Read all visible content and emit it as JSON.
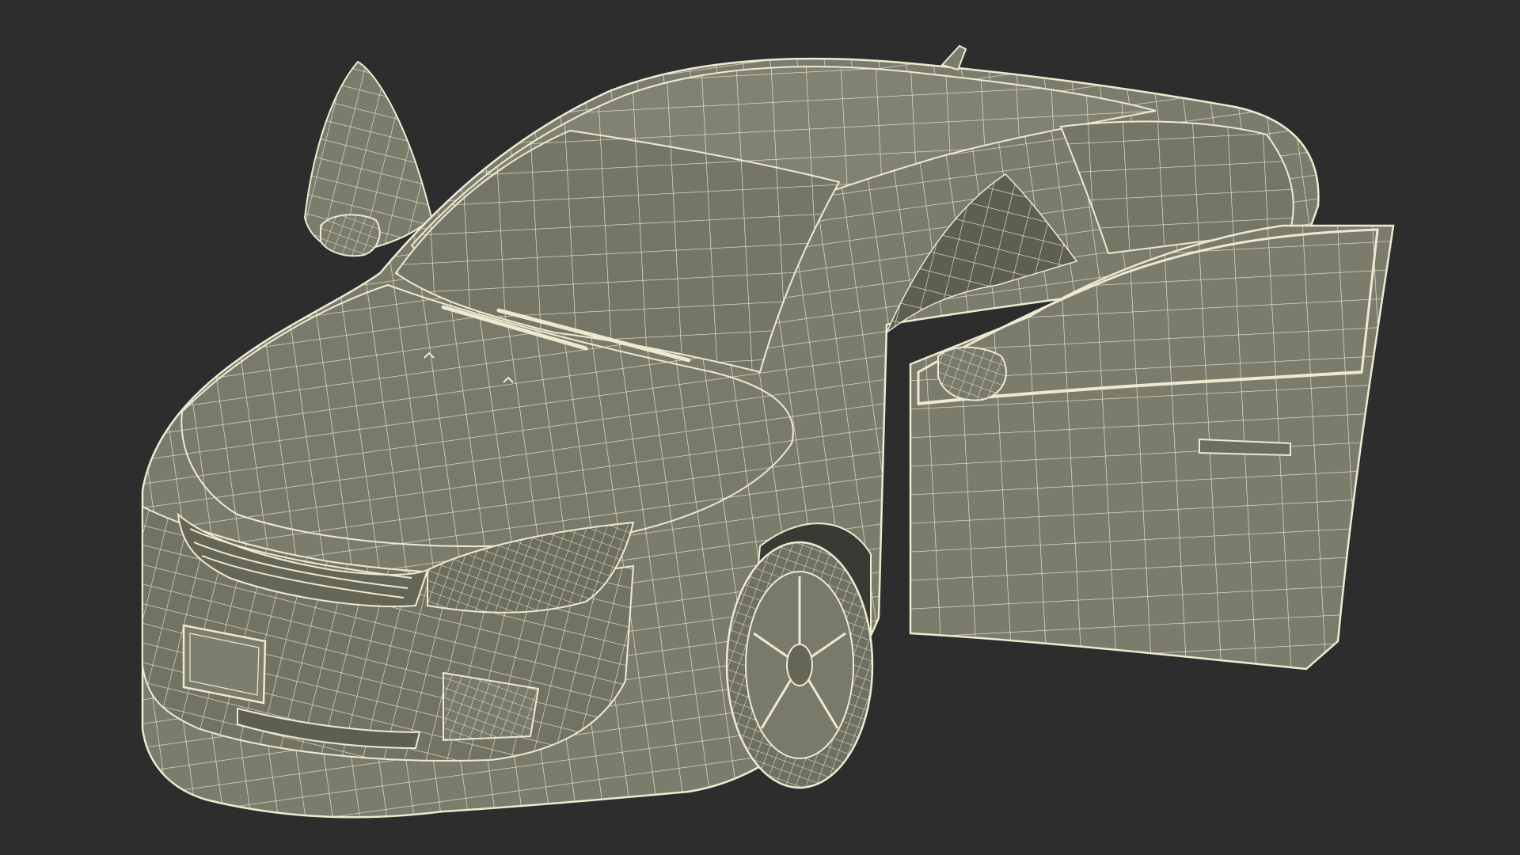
{
  "scene": {
    "subject_icon": "wireframe-car-icon",
    "colors": {
      "background": "#2d2d2d",
      "surface": "#7c7c6d",
      "surface_dark": "#666657",
      "surface_light": "#8a8a7a",
      "wire": "#ecebd2",
      "wire_dim": "#cfcdb3"
    }
  }
}
